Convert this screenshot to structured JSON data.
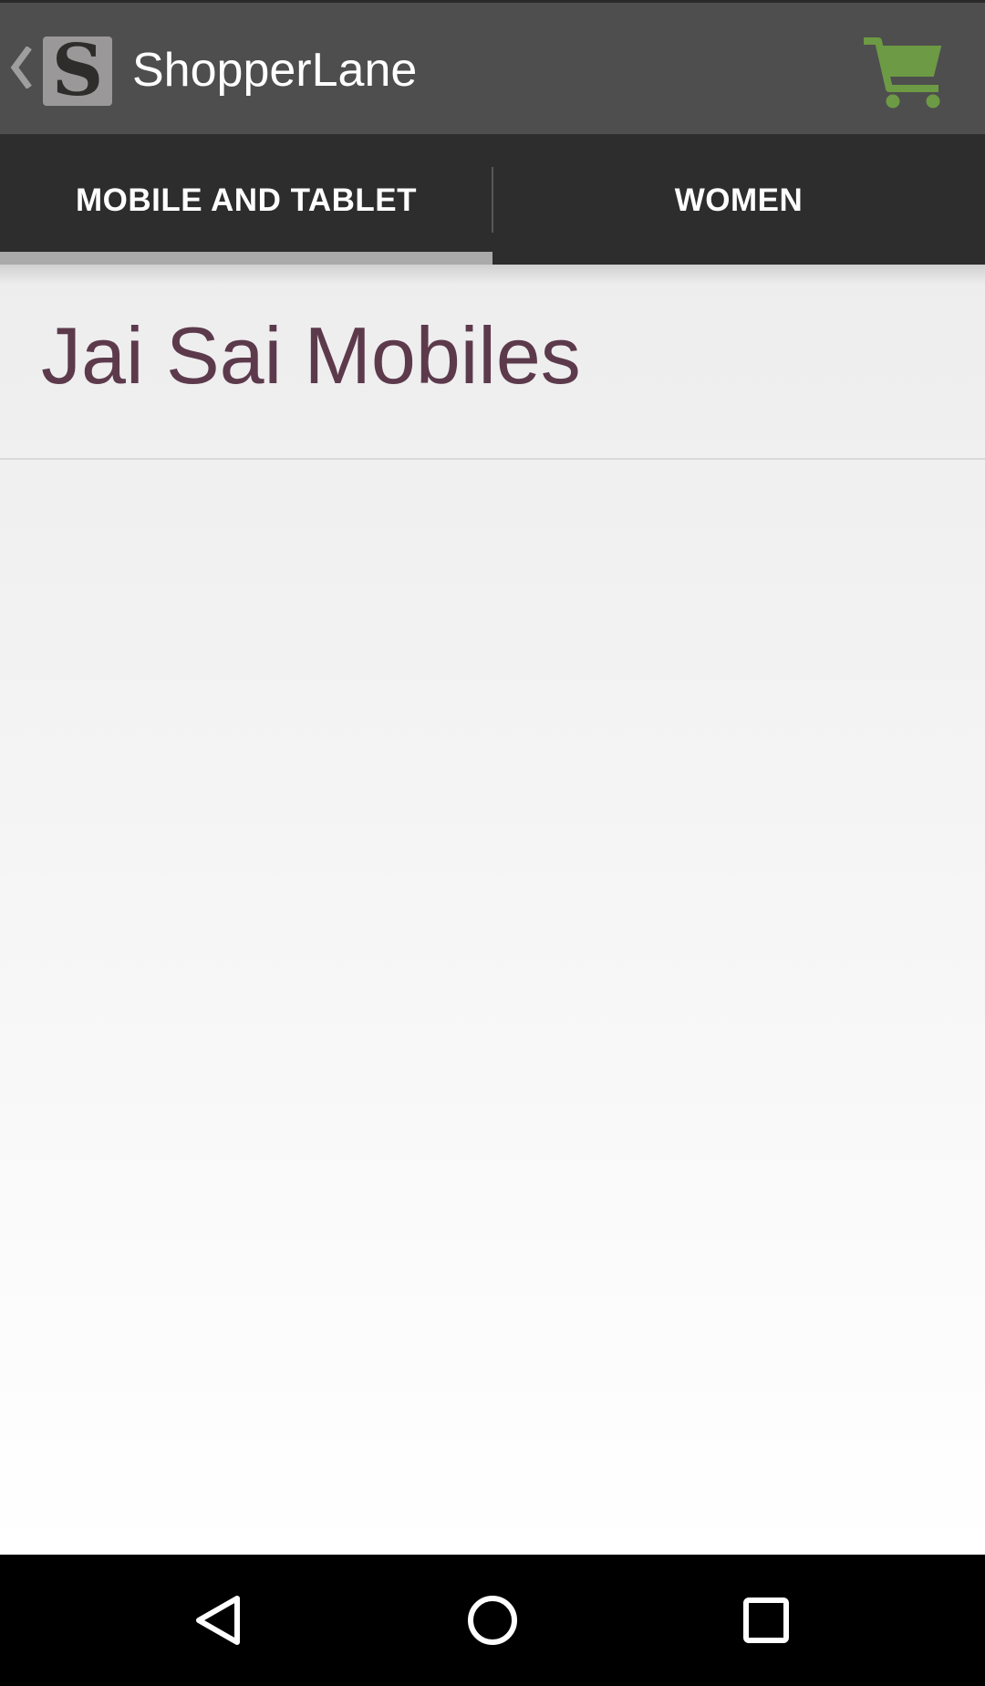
{
  "app": {
    "title": "ShopperLane",
    "logo_letter": "S",
    "up_icon": "chevron-left-icon",
    "cart_icon": "shopping-cart-icon"
  },
  "tabs": [
    {
      "label": "MOBILE AND TABLET",
      "selected": true
    },
    {
      "label": "WOMEN",
      "selected": false
    }
  ],
  "content": {
    "store_name": "Jai Sai Mobiles"
  },
  "navigation": {
    "back_icon": "back-triangle-icon",
    "home_icon": "home-circle-icon",
    "recents_icon": "recents-square-icon"
  },
  "colors": {
    "action_bar": "#4e4e4e",
    "tab_bar": "#2d2d2d",
    "tab_indicator": "#aaaaaa",
    "cart": "#6d9a44",
    "store_name": "#5c3a4c",
    "nav_bar": "#000000"
  }
}
